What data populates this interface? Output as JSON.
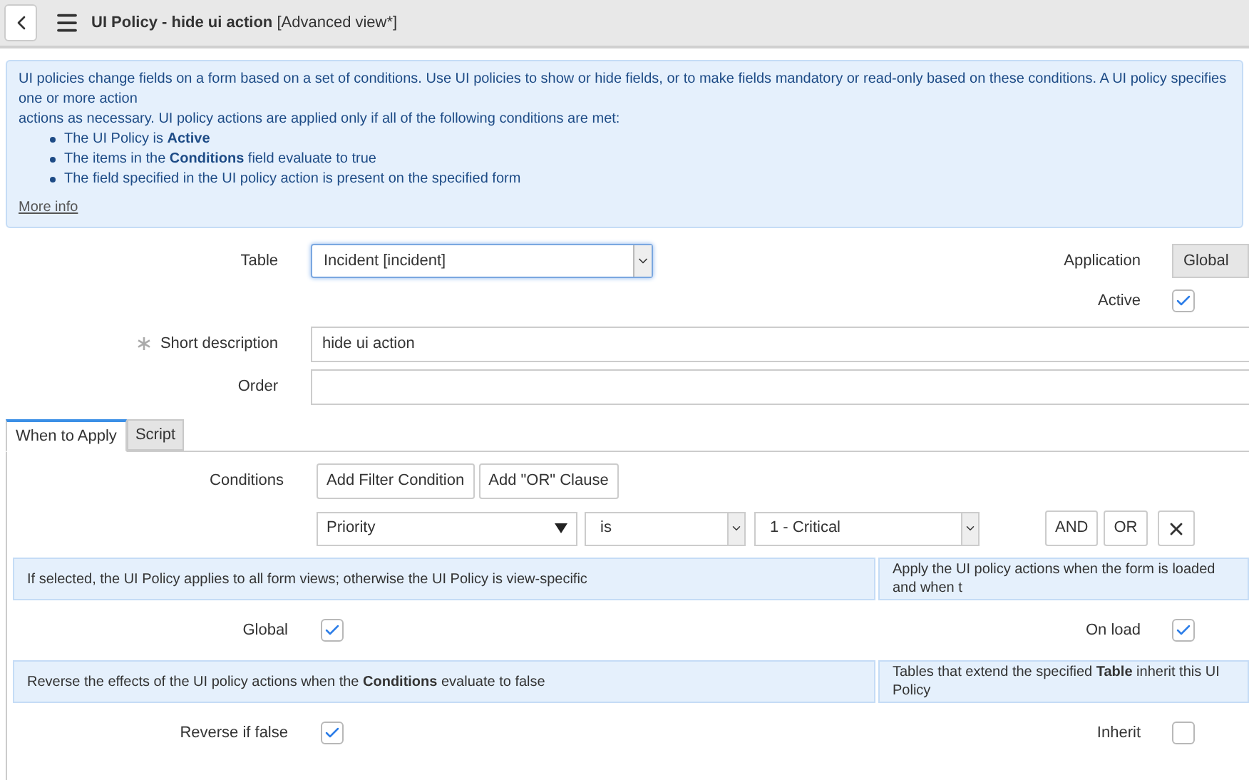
{
  "header": {
    "title": "UI Policy - hide ui action",
    "view": "[Advanced view*]"
  },
  "info": {
    "intro": "UI policies change fields on a form based on a set of conditions. Use UI policies to show or hide fields, or to make fields mandatory or read-only based on these conditions. A UI policy specifies one or more action",
    "intro_rest": "actions as necessary. UI policy actions are applied only if all of the following conditions are met:",
    "bullets": [
      "The UI Policy is **Active**",
      "The items in the **Conditions** field evaluate to true",
      "The field specified in the UI policy action is present on the specified form"
    ],
    "link": "More info"
  },
  "table_field": {
    "label": "Table",
    "value": "Incident [incident]"
  },
  "application_field": {
    "label": "Application",
    "value": "Global"
  },
  "active_field": {
    "label": "Active",
    "checked": true
  },
  "short_description": {
    "label": "Short description",
    "value": "hide ui action",
    "required": true
  },
  "order_field": {
    "label": "Order"
  },
  "tabs": [
    {
      "label": "When to Apply",
      "selected": true
    },
    {
      "label": "Script",
      "selected": false
    }
  ],
  "conditions": {
    "label": "Conditions",
    "buttons": [
      "Add Filter Condition",
      "Add \"OR\" Clause"
    ],
    "filter": {
      "field": "Priority",
      "operator": "is",
      "value": "1 - Critical"
    },
    "logic_buttons": [
      "AND",
      "OR"
    ]
  },
  "options": [
    {
      "hint": "If selected, the UI Policy applies to all form views; otherwise the UI Policy is view-specific",
      "label": "Global",
      "checked": true
    },
    {
      "hint": "Apply the UI policy actions when the form is loaded and when t",
      "label": "On load",
      "checked": true
    },
    {
      "hint": "Reverse the effects of the UI policy actions when the **Conditions** evaluate to false",
      "label": "Reverse if false",
      "checked": true
    },
    {
      "hint": "Tables that extend the specified **Table** inherit this UI Policy",
      "label": "Inherit",
      "checked": false
    }
  ]
}
